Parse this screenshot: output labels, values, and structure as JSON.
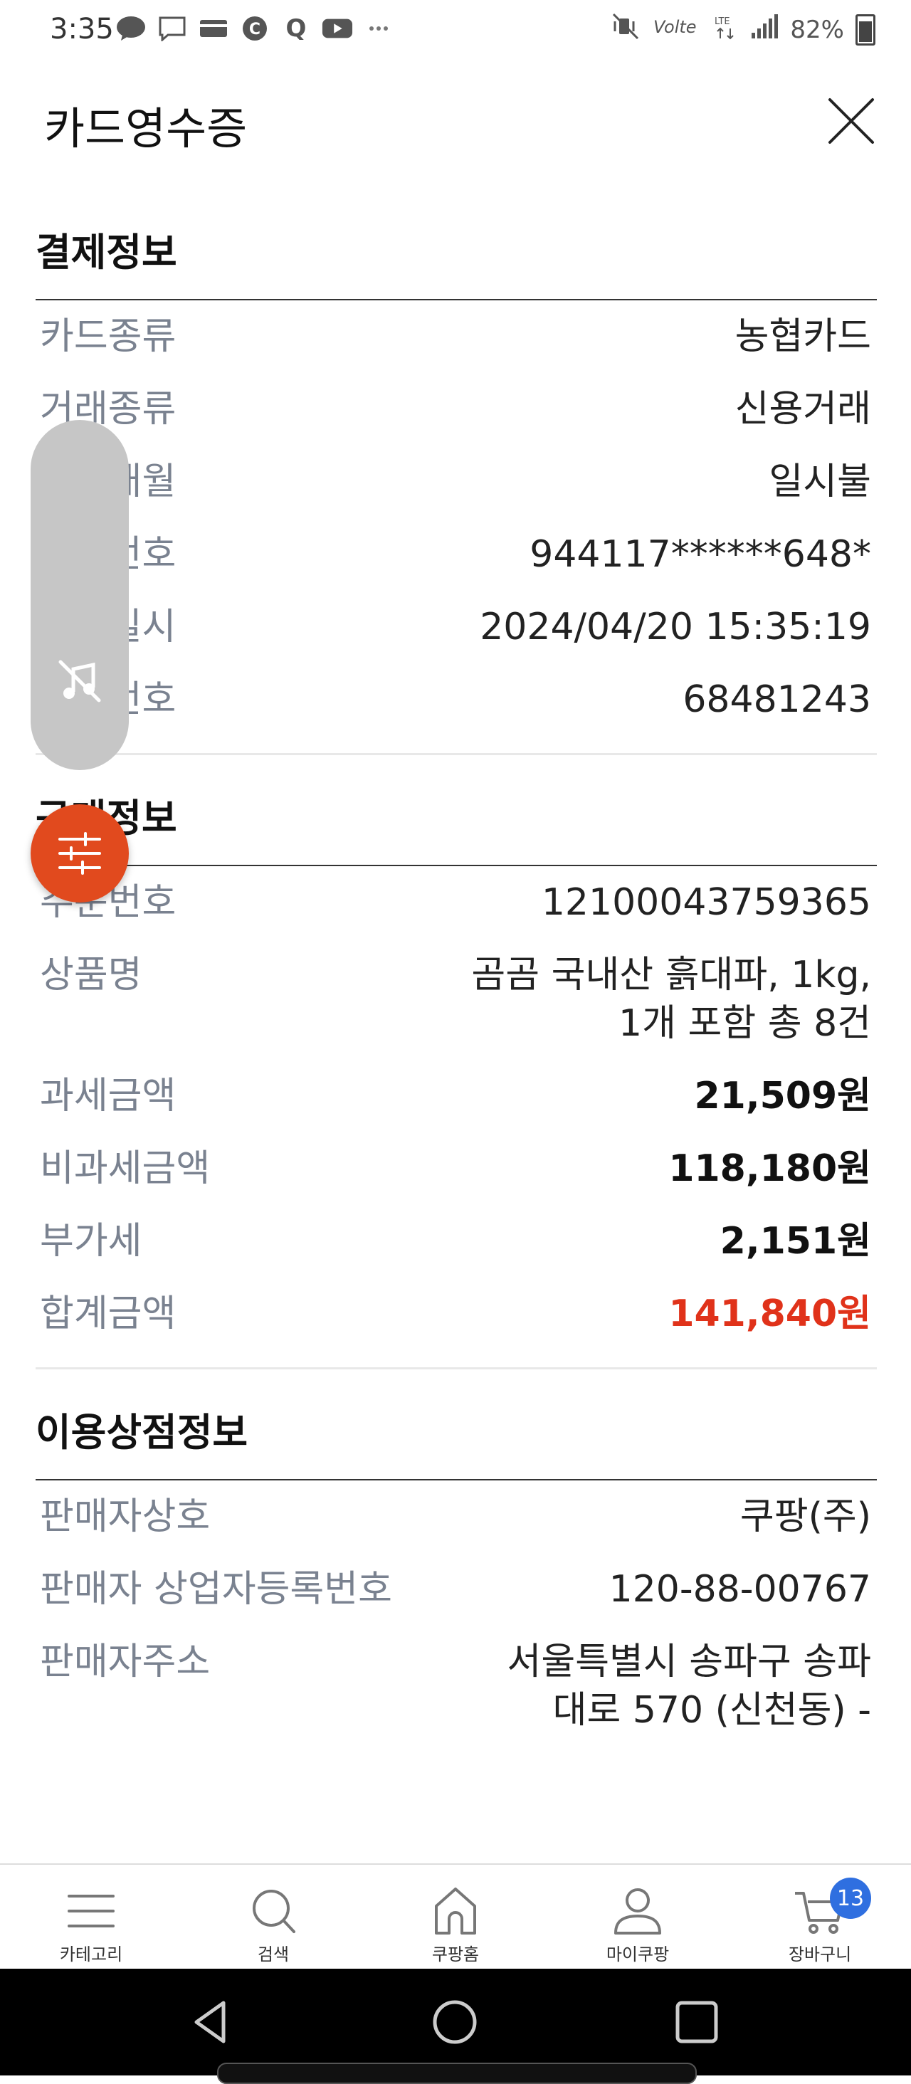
{
  "status_bar": {
    "time": "3:35",
    "battery": "82%"
  },
  "header": {
    "title": "카드영수증"
  },
  "payment_info": {
    "title": "결제정보",
    "rows": [
      {
        "label": "카드종류",
        "value": "농협카드"
      },
      {
        "label": "거래종류",
        "value": "신용거래"
      },
      {
        "label": "할부개월",
        "value": "일시불"
      },
      {
        "label": "카드번호",
        "value": "944117******648*"
      },
      {
        "label": "거래일시",
        "value": "2024/04/20 15:35:19"
      },
      {
        "label": "승인번호",
        "value": "68481243"
      }
    ]
  },
  "order_info": {
    "title": "구매정보",
    "rows": [
      {
        "label": "주문번호",
        "value": "12100043759365"
      },
      {
        "label": "상품명",
        "value_line1": "곰곰 국내산 흙대파, 1kg,",
        "value_line2": "1개 포함 총 8건"
      },
      {
        "label": "과세금액",
        "value": "21,509원"
      },
      {
        "label": "비과세금액",
        "value": "118,180원"
      },
      {
        "label": "부가세",
        "value": "2,151원"
      },
      {
        "label": "합계금액",
        "value": "141,840원"
      }
    ]
  },
  "merchant_info": {
    "title": "이용상점정보",
    "rows": [
      {
        "label": "판매자상호",
        "value": "쿠팡(주)"
      },
      {
        "label": "판매자 상업자등록번호",
        "value": "120-88-00767"
      },
      {
        "label": "판매자주소",
        "value_line1": "서울특별시 송파구 송파",
        "value_line2": "대로 570 (신천동) -"
      }
    ]
  },
  "bottom_nav": {
    "items": [
      {
        "label": "카테고리",
        "icon": "menu-icon"
      },
      {
        "label": "검색",
        "icon": "search-icon"
      },
      {
        "label": "쿠팡홈",
        "icon": "home-icon"
      },
      {
        "label": "마이쿠팡",
        "icon": "user-icon"
      },
      {
        "label": "장바구니",
        "icon": "cart-icon"
      }
    ],
    "cart_count": "13"
  },
  "colors": {
    "accent_red": "#e0321a",
    "fab_orange": "#e14a1e",
    "badge_blue": "#2f6fe0"
  }
}
